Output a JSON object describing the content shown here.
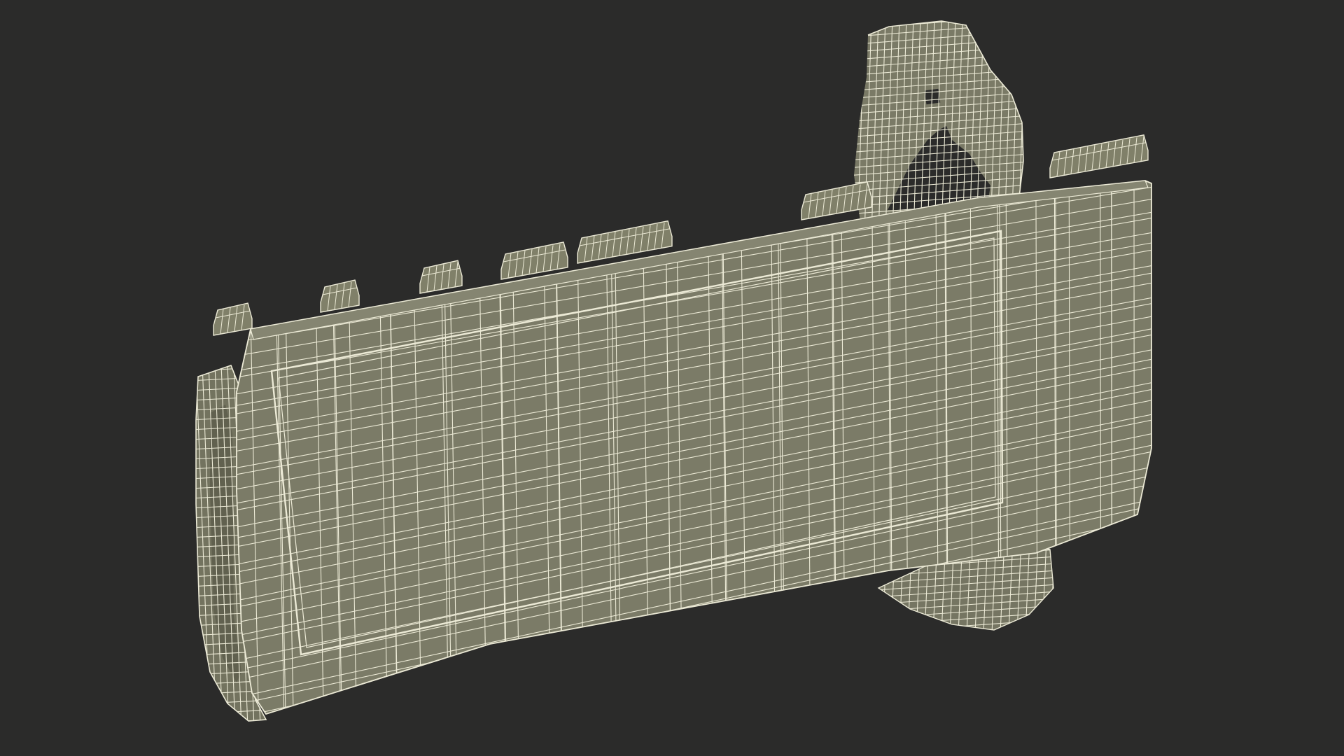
{
  "scene": {
    "background_color": "#2b2b2a",
    "mesh_fill_color": "#7a7a66",
    "mesh_shadow_color": "#6a6a58",
    "wire_color": "#ecead6",
    "object": "wireframe-rail-handguard-model"
  }
}
